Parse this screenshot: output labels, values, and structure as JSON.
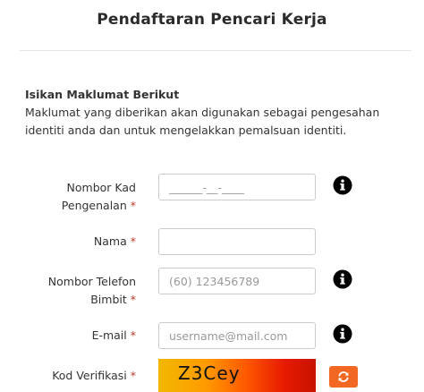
{
  "page": {
    "title": "Pendaftaran Pencari Kerja"
  },
  "section": {
    "heading": "Isikan Maklumat Berikut",
    "description": "Maklumat yang diberikan akan digunakan sebagai pengesahan identiti anda dan untuk mengelakkan pemalsuan identiti."
  },
  "form": {
    "required_marker": "*",
    "ic": {
      "label_line1": "Nombor Kad",
      "label_line2": "Pengenalan",
      "placeholder": "______-__-____",
      "value": ""
    },
    "name": {
      "label": "Nama",
      "placeholder": "",
      "value": ""
    },
    "phone": {
      "label_line1": "Nombor Telefon",
      "label_line2": "Bimbit",
      "placeholder": "(60) 123456789",
      "value": ""
    },
    "email": {
      "label": "E-mail",
      "placeholder": "username@mail.com",
      "value": ""
    },
    "captcha": {
      "label": "Kod Verifikasi",
      "code": "Z3Cey"
    }
  },
  "icons": {
    "info": "info-circle-icon",
    "refresh": "refresh-icon"
  },
  "colors": {
    "required": "#c0392b",
    "refresh_button": "#f26722",
    "info_icon": "#000000"
  }
}
